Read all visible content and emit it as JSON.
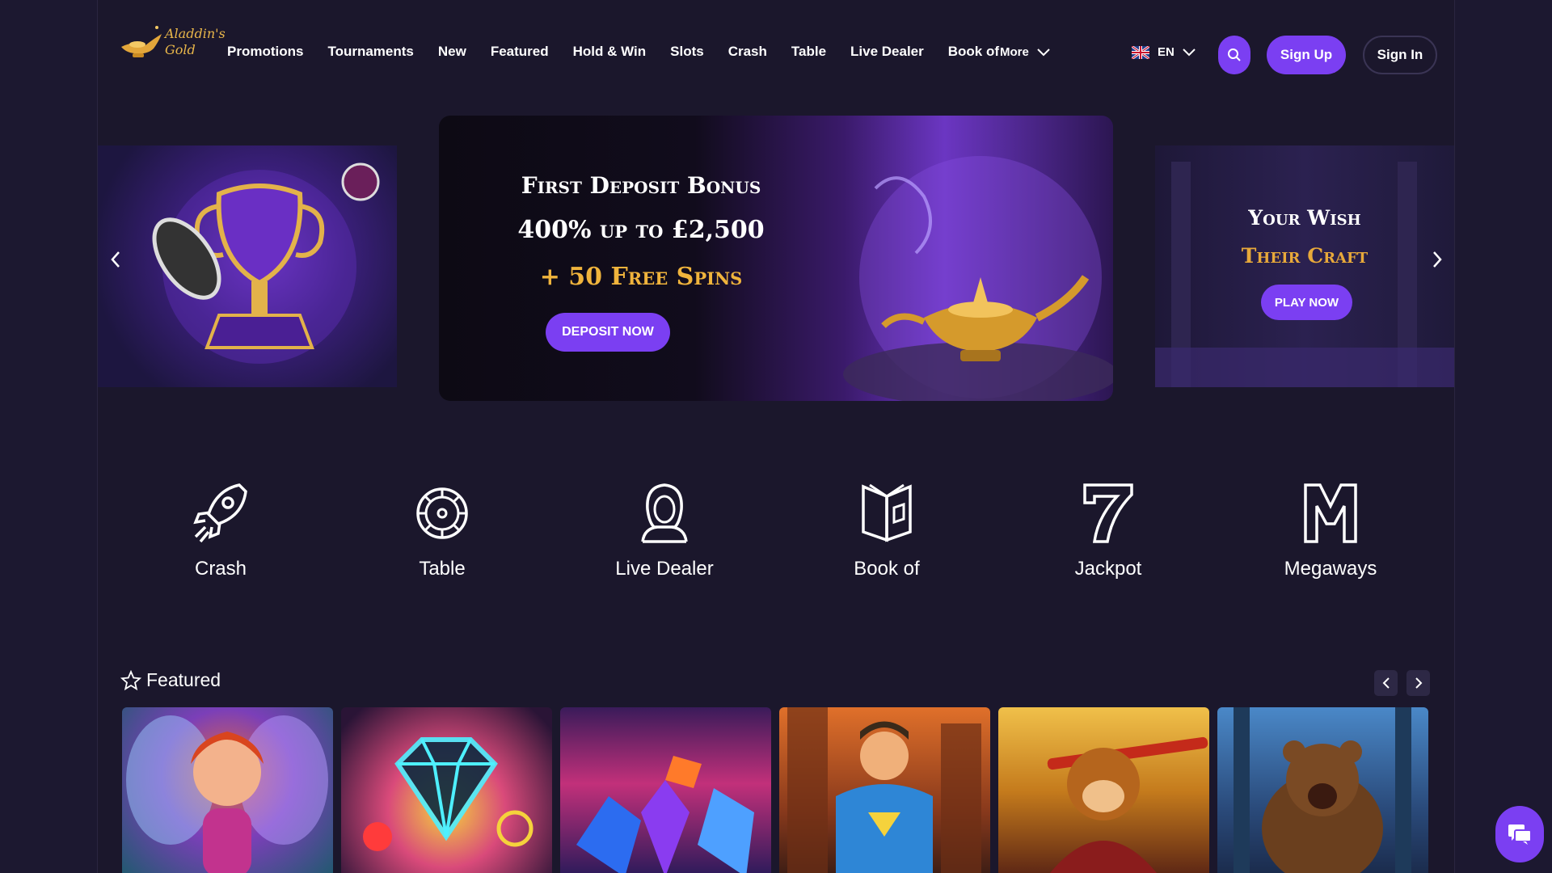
{
  "header": {
    "logo_text": "Aladdin's Gold",
    "nav": [
      "Promotions",
      "Tournaments",
      "New",
      "Featured",
      "Hold & Win",
      "Slots",
      "Crash",
      "Table",
      "Live Dealer",
      "Book of"
    ],
    "more_label": "More",
    "language": "EN",
    "signup_label": "Sign Up",
    "signin_label": "Sign In"
  },
  "carousel": {
    "main": {
      "line1": "First Deposit Bonus",
      "line2": "400% up to £2,500",
      "line3": "+ 50 Free Spins",
      "button": "DEPOSIT NOW"
    },
    "right": {
      "line1": "Your Wish",
      "line2": "Their Craft",
      "button": "PLAY NOW"
    }
  },
  "categories": [
    {
      "label": "Crash",
      "icon": "rocket-icon"
    },
    {
      "label": "Table",
      "icon": "roulette-icon"
    },
    {
      "label": "Live Dealer",
      "icon": "dealer-icon"
    },
    {
      "label": "Book of",
      "icon": "book-icon"
    },
    {
      "label": "Jackpot",
      "icon": "seven-icon"
    },
    {
      "label": "Megaways",
      "icon": "megaways-icon"
    }
  ],
  "featured": {
    "title": "Featured",
    "games": [
      "fairy-game",
      "neon-diamond-game",
      "gems-game",
      "superhero-game",
      "monkey-king-game",
      "bear-game"
    ]
  },
  "colors": {
    "background": "#1b172c",
    "accent": "#7b3ff2",
    "gold": "#f0b43c"
  }
}
